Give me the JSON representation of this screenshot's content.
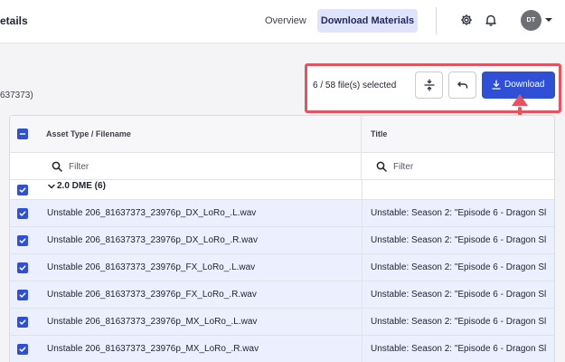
{
  "header": {
    "page_title": "etails",
    "nav": {
      "overview": "Overview",
      "download_materials": "Download Materials"
    },
    "avatar_initials": "DT",
    "icons": [
      "gear-icon",
      "bell-icon",
      "chevron-down-icon"
    ]
  },
  "sub_header": {
    "id_text": "637373)"
  },
  "toolbar": {
    "selection_count": "6 / 58 file(s) selected",
    "download_label": "Download",
    "icons": [
      "collapse-icon",
      "undo-icon",
      "download-icon"
    ]
  },
  "table": {
    "columns": {
      "asset": "Asset Type / Filename",
      "title": "Title"
    },
    "filter_placeholder": "Filter",
    "group": {
      "label": "2.0 DME (6)"
    },
    "rows": [
      {
        "asset": "Unstable 206_81637373_23976p_DX_LoRo_.L.wav",
        "title": "Unstable: Season 2: \"Episode 6 - Dragon Sl"
      },
      {
        "asset": "Unstable 206_81637373_23976p_DX_LoRo_.R.wav",
        "title": "Unstable: Season 2: \"Episode 6 - Dragon Sl"
      },
      {
        "asset": "Unstable 206_81637373_23976p_FX_LoRo_.L.wav",
        "title": "Unstable: Season 2: \"Episode 6 - Dragon Sl"
      },
      {
        "asset": "Unstable 206_81637373_23976p_FX_LoRo_.R.wav",
        "title": "Unstable: Season 2: \"Episode 6 - Dragon Sl"
      },
      {
        "asset": "Unstable 206_81637373_23976p_MX_LoRo_.L.wav",
        "title": "Unstable: Season 2: \"Episode 6 - Dragon Sl"
      },
      {
        "asset": "Unstable 206_81637373_23976p_MX_LoRo_.R.wav",
        "title": "Unstable: Season 2: \"Episode 6 - Dragon Sl"
      }
    ]
  },
  "colors": {
    "accent": "#2e4fd6",
    "highlight": "#e8525e",
    "selected_row": "#eceffd",
    "active_tab": "#dfe3fb"
  }
}
